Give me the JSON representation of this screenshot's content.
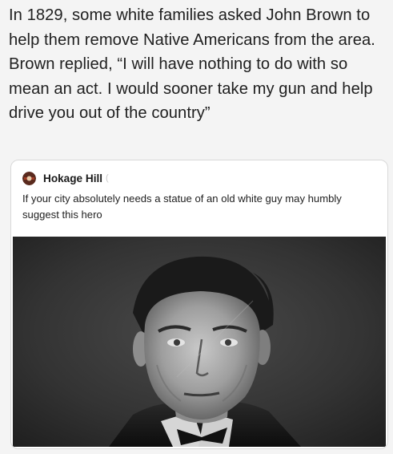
{
  "caption": "In 1829, some white families asked John Brown to help them remove Native Americans from the area. Brown replied, “I will have nothing to do with so mean an act. I would sooner take my gun and help drive you out of the country”",
  "post": {
    "author": "Hokage Hill",
    "extra": "(",
    "body": "If your city absolutely needs a statue of an old white guy may humbly suggest this hero",
    "photo_icon": "portrait-photo-icon",
    "avatar_icon": "avatar-icon"
  },
  "colors": {
    "page_background": "#f4f4f4",
    "card_background": "#ffffff",
    "text": "#202020"
  }
}
